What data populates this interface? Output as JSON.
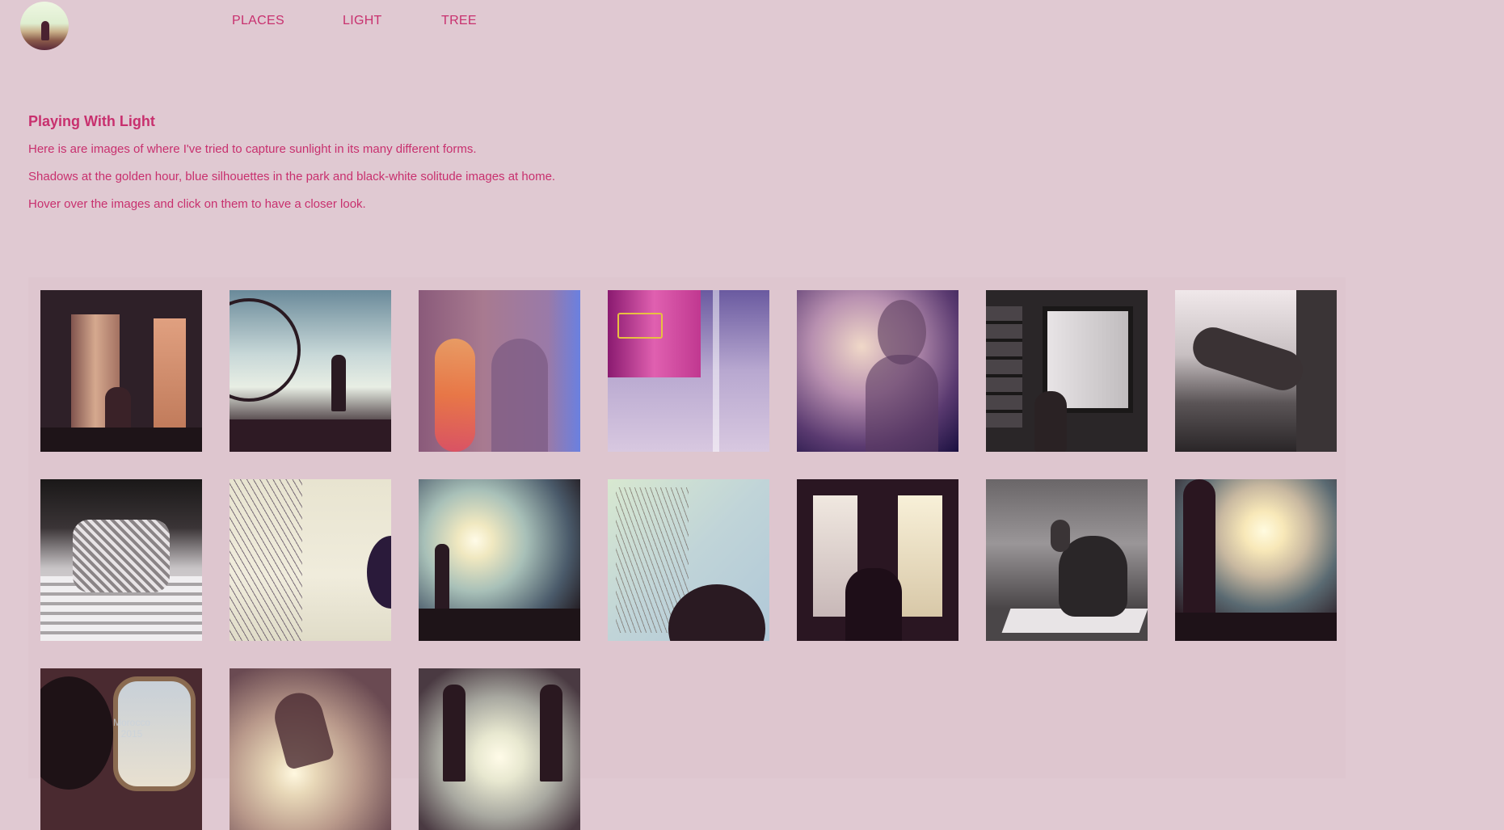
{
  "nav": {
    "avatar_icon": "profile-photo-icon",
    "items": [
      {
        "label": "PLACES"
      },
      {
        "label": "LIGHT"
      },
      {
        "label": "TREE"
      }
    ]
  },
  "intro": {
    "title": "Playing With Light",
    "lines": [
      "Here is are images of where I've tried to capture sunlight in its many different forms.",
      "Shadows at the golden hour, blue silhouettes in the park and black-white solitude images at home.",
      "Hover over the images and click on them to have a closer look."
    ]
  },
  "colors": {
    "background": "#e0c9d2",
    "accent": "#c8306e"
  },
  "gallery": {
    "images": [
      {
        "name": "curtain-room-photo"
      },
      {
        "name": "bicycle-wheel-sky-photo"
      },
      {
        "name": "orange-shadow-profile-photo"
      },
      {
        "name": "pink-window-reflection-photo"
      },
      {
        "name": "violet-silhouette-photo"
      },
      {
        "name": "bookshelf-window-portrait-photo"
      },
      {
        "name": "bw-hand-table-photo"
      },
      {
        "name": "bw-sleeve-stripes-photo"
      },
      {
        "name": "bare-branches-photo"
      },
      {
        "name": "sun-silhouette-field-photo"
      },
      {
        "name": "tree-sky-head-photo"
      },
      {
        "name": "bay-window-silhouette-photo"
      },
      {
        "name": "bw-beanbag-photo"
      },
      {
        "name": "sunburst-figure-photo"
      },
      {
        "name": "airplane-window-photo",
        "caption": "Morocco\n2015"
      },
      {
        "name": "dancing-sunset-photo"
      },
      {
        "name": "two-silhouettes-photo"
      }
    ]
  }
}
